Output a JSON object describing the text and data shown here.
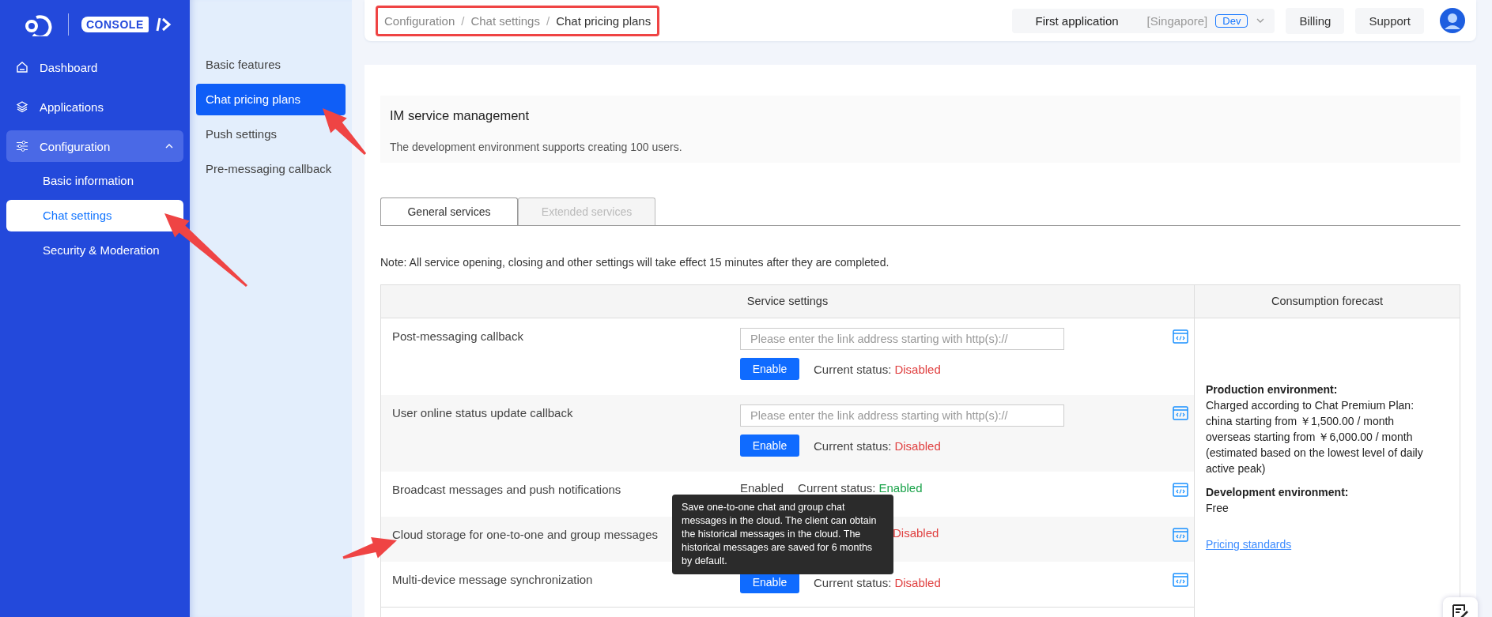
{
  "sidebar": {
    "logo_text": "CONSOLE",
    "items": [
      {
        "label": "Dashboard",
        "kind": "link",
        "selected": false
      },
      {
        "label": "Applications",
        "kind": "link",
        "selected": false
      },
      {
        "label": "Configuration",
        "kind": "group",
        "selected": false,
        "expanded": true,
        "children": [
          {
            "label": "Basic information",
            "selected": false
          },
          {
            "label": "Chat settings",
            "selected": true
          },
          {
            "label": "Security & Moderation",
            "selected": false
          }
        ]
      }
    ]
  },
  "subnav": [
    {
      "label": "Basic features",
      "selected": false
    },
    {
      "label": "Chat pricing plans",
      "selected": true
    },
    {
      "label": "Push settings",
      "selected": false
    },
    {
      "label": "Pre-messaging callback",
      "selected": false
    }
  ],
  "topbar": {
    "breadcrumb": [
      "Configuration",
      "Chat settings",
      "Chat pricing plans"
    ],
    "breadcrumb_separator": "/",
    "breadcrumb_highlighted": true,
    "app": {
      "name": "First application",
      "region": "[Singapore]",
      "env": "Dev"
    },
    "buttons": [
      "Billing",
      "Support"
    ]
  },
  "panel": {
    "title": "IM service management",
    "description": "The development environment supports creating 100 users."
  },
  "tabs": [
    {
      "label": "General services",
      "selected": true
    },
    {
      "label": "Extended services",
      "selected": false
    }
  ],
  "note": "Note: All service opening, closing and other settings will take effect 15 minutes after they are completed.",
  "table": {
    "columns": [
      "Service settings",
      "Consumption forecast"
    ],
    "rows": [
      {
        "name": "Post-messaging callback",
        "kind": "callback",
        "placeholder": "Please enter the link address starting with http(s)://",
        "button": "Enable",
        "status_label": "Current status:",
        "status": "Disabled",
        "enabled": false
      },
      {
        "name": "User online status update callback",
        "kind": "callback",
        "placeholder": "Please enter the link address starting with http(s)://",
        "button": "Enable",
        "status_label": "Current status:",
        "status": "Disabled",
        "enabled": false
      },
      {
        "name": "Broadcast messages and push notifications",
        "kind": "fixed",
        "value": "Enabled",
        "status_label": "Current status:",
        "status": "Enabled",
        "enabled": true
      },
      {
        "name": "Cloud storage for one-to-one and group messages",
        "kind": "covered",
        "status": "Disabled",
        "enabled": false
      },
      {
        "name": "Multi-device message synchronization",
        "kind": "button",
        "button": "Enable",
        "status_label": "Current status:",
        "status": "Disabled",
        "enabled": false
      }
    ],
    "forecast": {
      "production_title": "Production environment:",
      "production_lines": [
        "Charged according to Chat Premium Plan:",
        "china starting from ￥1,500.00 / month",
        "overseas starting from ￥6,000.00 / month",
        "  (estimated based on the lowest level of daily active peak)"
      ],
      "development_title": "Development environment:",
      "development_value": "Free",
      "link": "Pricing standards"
    }
  },
  "tooltip": {
    "text": "Save one-to-one chat and group chat messages in the cloud. The client can obtain the historical messages in the cloud. The historical messages are saved for 6 months by default."
  }
}
